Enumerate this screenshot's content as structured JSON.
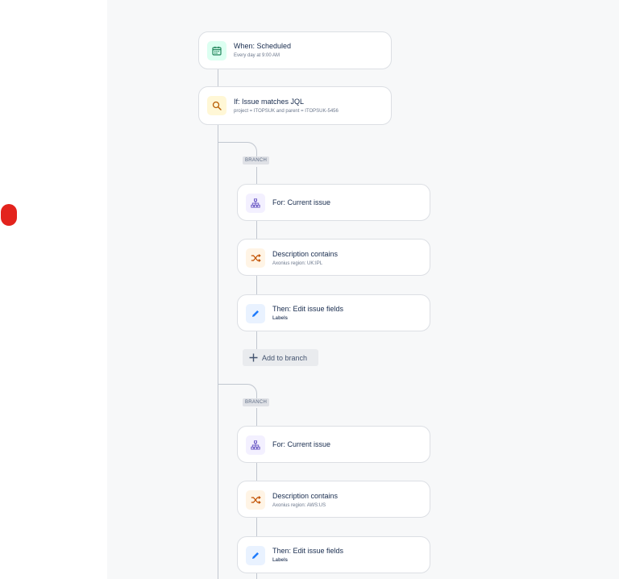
{
  "colors": {
    "connector": "#c1c7d0",
    "canvas_bg": "#f7f8f9",
    "red_marker": "#e3231d"
  },
  "trigger": {
    "icon": "calendar-icon",
    "title": "When: Scheduled",
    "subtitle": "Every day at 9:00 AM"
  },
  "condition": {
    "icon": "search-icon",
    "title": "If: Issue matches JQL",
    "subtitle": "project = ITOPSUK and parent = ITOPSUK-5456"
  },
  "branches": [
    {
      "tag": "BRANCH",
      "for": {
        "icon": "hierarchy-icon",
        "title": "For: Current issue"
      },
      "condition": {
        "icon": "shuffle-icon",
        "title": "Description contains",
        "subtitle": "Axonius region: UK:IPL"
      },
      "action": {
        "icon": "pencil-icon",
        "title": "Then: Edit issue fields",
        "subtitle": "Labels"
      },
      "add_label": "Add to branch"
    },
    {
      "tag": "BRANCH",
      "for": {
        "icon": "hierarchy-icon",
        "title": "For: Current issue"
      },
      "condition": {
        "icon": "shuffle-icon",
        "title": "Description contains",
        "subtitle": "Axonius region: AWS:US"
      },
      "action": {
        "icon": "pencil-icon",
        "title": "Then: Edit issue fields",
        "subtitle": "Labels"
      }
    }
  ]
}
